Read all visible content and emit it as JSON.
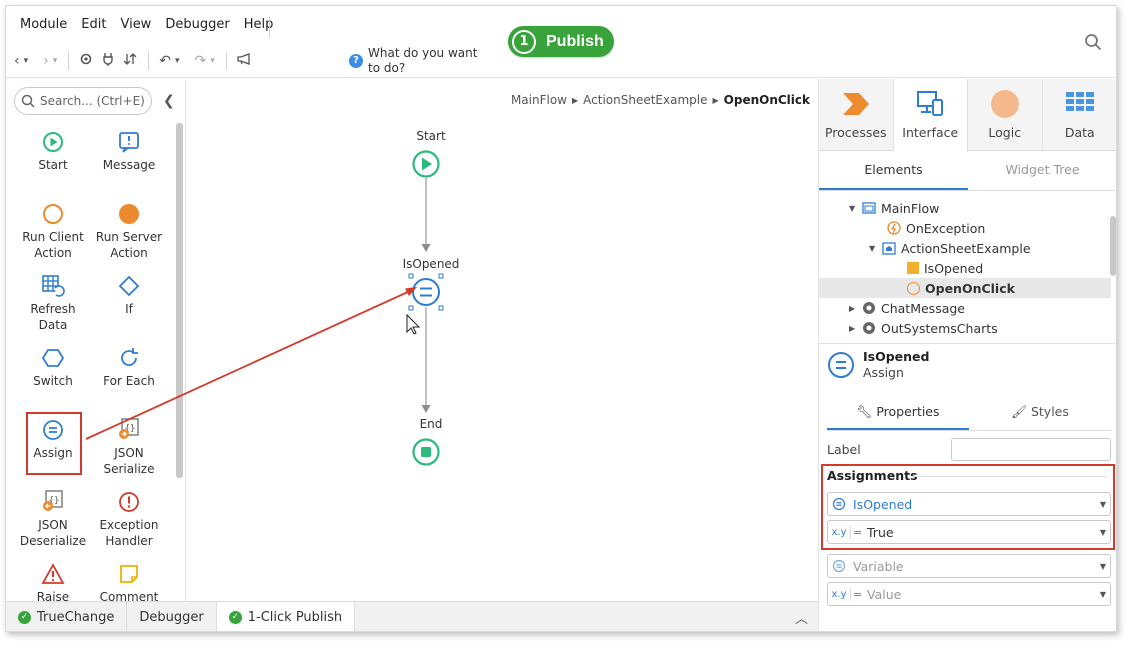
{
  "menu": [
    "Module",
    "Edit",
    "View",
    "Debugger",
    "Help"
  ],
  "toolbar": {
    "what_do": "What do you want to do?",
    "publish_number": "1",
    "publish_label": "Publish"
  },
  "toolbox": {
    "search_placeholder": "Search... (Ctrl+E)",
    "tools": [
      {
        "label": "Start",
        "icon": "start-icon"
      },
      {
        "label": "Message",
        "icon": "message-icon"
      },
      {
        "label": "Run Client Action",
        "icon": "run-client-action-icon"
      },
      {
        "label": "Run Server Action",
        "icon": "run-server-action-icon"
      },
      {
        "label": "Refresh Data",
        "icon": "refresh-data-icon"
      },
      {
        "label": "If",
        "icon": "if-icon"
      },
      {
        "label": "Switch",
        "icon": "switch-icon"
      },
      {
        "label": "For Each",
        "icon": "for-each-icon"
      },
      {
        "label": "Assign",
        "icon": "assign-icon"
      },
      {
        "label": "JSON Serialize",
        "icon": "json-serialize-icon"
      },
      {
        "label": "JSON Deserialize",
        "icon": "json-deserialize-icon"
      },
      {
        "label": "Exception Handler",
        "icon": "exception-handler-icon"
      },
      {
        "label": "Raise",
        "icon": "raise-icon"
      },
      {
        "label": "Comment",
        "icon": "comment-icon"
      }
    ]
  },
  "canvas": {
    "breadcrumb": [
      "MainFlow",
      "ActionSheetExample",
      "OpenOnClick"
    ],
    "nodes": {
      "start": "Start",
      "assign": "IsOpened",
      "end": "End"
    }
  },
  "bottom_tabs": [
    {
      "label": "TrueChange",
      "status": "ok"
    },
    {
      "label": "Debugger",
      "status": "none"
    },
    {
      "label": "1-Click Publish",
      "status": "ok"
    }
  ],
  "right_panel": {
    "tabs": [
      "Processes",
      "Interface",
      "Logic",
      "Data"
    ],
    "active_tab": "Interface",
    "subtabs": [
      "Elements",
      "Widget Tree"
    ],
    "tree": [
      {
        "label": "MainFlow",
        "level": 1,
        "expanded": true
      },
      {
        "label": "OnException",
        "level": 2
      },
      {
        "label": "ActionSheetExample",
        "level": 2,
        "expanded": true
      },
      {
        "label": "IsOpened",
        "level": 3
      },
      {
        "label": "OpenOnClick",
        "level": 3,
        "selected": true
      },
      {
        "label": "ChatMessage",
        "level": 1,
        "expanded": false
      },
      {
        "label": "OutSystemsCharts",
        "level": 1,
        "expanded": false
      }
    ],
    "properties": {
      "title": "IsOpened",
      "subtitle": "Assign",
      "tabs": [
        "Properties",
        "Styles"
      ],
      "label_caption": "Label",
      "label_value": "",
      "assignments_title": "Assignments",
      "assignments": [
        {
          "variable": "IsOpened",
          "value": "True"
        }
      ],
      "new_assignment": {
        "variable_placeholder": "Variable",
        "value_placeholder": "Value"
      },
      "value_prefix": "x.y",
      "equals": "="
    }
  },
  "colors": {
    "publish": "#37a33a",
    "highlight": "#d23a2c",
    "flow_green": "#2dbb7d",
    "flow_blue": "#2f7dd1"
  }
}
